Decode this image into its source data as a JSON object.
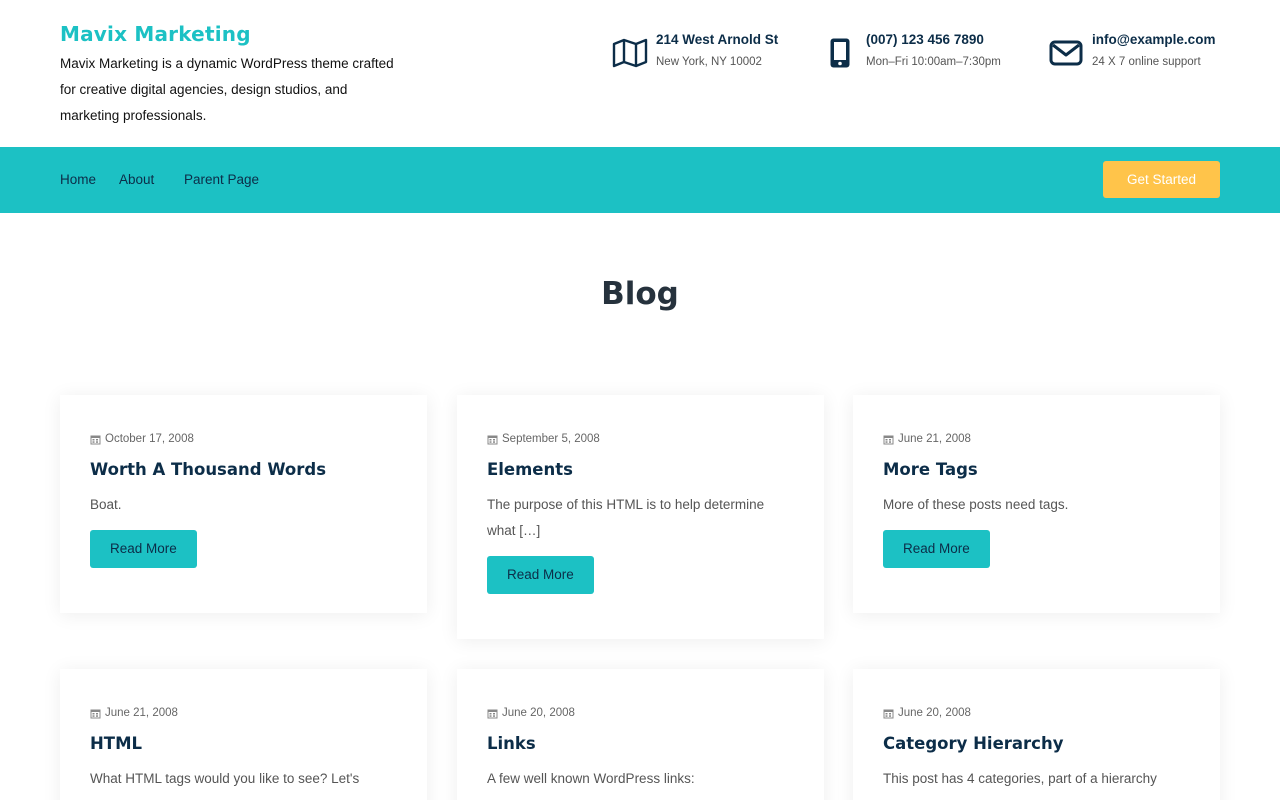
{
  "site": {
    "title": "Mavix Marketing",
    "description": "Mavix Marketing is a dynamic WordPress theme crafted for creative digital agencies, design studios, and marketing professionals."
  },
  "contacts": [
    {
      "icon": "map-icon",
      "title": "214 West Arnold St",
      "sub": "New York, NY 10002"
    },
    {
      "icon": "mobile-phone-icon",
      "title": "(007) 123 456 7890",
      "sub": "Mon–Fri 10:00am–7:30pm"
    },
    {
      "icon": "envelope-icon",
      "title": "info@example.com",
      "sub": "24 X 7 online support"
    }
  ],
  "nav": {
    "items": [
      "Home",
      "About",
      "Parent Page"
    ],
    "cta": "Get Started"
  },
  "page_title": "Blog",
  "posts": [
    {
      "date": "October 17, 2008",
      "title": "Worth A Thousand Words",
      "excerpt": "Boat.",
      "button": "Read More"
    },
    {
      "date": "September 5, 2008",
      "title": "Elements",
      "excerpt": "The purpose of this HTML is to help determine what […]",
      "button": "Read More"
    },
    {
      "date": "June 21, 2008",
      "title": "More Tags",
      "excerpt": "More of these posts need tags.",
      "button": "Read More"
    },
    {
      "date": "June 21, 2008",
      "title": "HTML",
      "excerpt": "What HTML tags would you like to see? Let's",
      "button": ""
    },
    {
      "date": "June 20, 2008",
      "title": "Links",
      "excerpt": "A few well known WordPress links:",
      "button": ""
    },
    {
      "date": "June 20, 2008",
      "title": "Category Hierarchy",
      "excerpt": "This post has 4 categories, part of a hierarchy",
      "button": ""
    }
  ],
  "colors": {
    "accent": "#1cc1c4",
    "cta": "#ffc44a",
    "heading": "#0c2d48"
  }
}
